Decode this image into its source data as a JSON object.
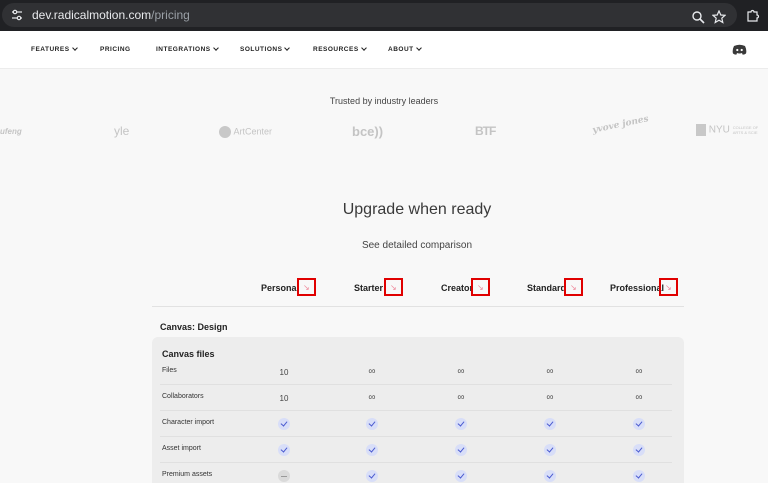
{
  "browser": {
    "url_host": "dev.radicalmotion.com",
    "url_path": "/pricing"
  },
  "nav": {
    "items": [
      {
        "label": "FEATURES",
        "dropdown": true
      },
      {
        "label": "PRICING",
        "dropdown": false
      },
      {
        "label": "INTEGRATIONS",
        "dropdown": true
      },
      {
        "label": "SOLUTIONS",
        "dropdown": true
      },
      {
        "label": "RESOURCES",
        "dropdown": true
      },
      {
        "label": "ABOUT",
        "dropdown": true
      }
    ]
  },
  "trusted": {
    "title": "Trusted by industry leaders",
    "logos": [
      "ufeng",
      "yle",
      "ArtCenter",
      "bce))",
      "BTF",
      "yvove jones",
      "NYU",
      "COLLEGE OF ARTS & SCIE"
    ]
  },
  "pricing": {
    "headline": "Upgrade when ready",
    "subheadline": "See detailed comparison",
    "plans": [
      "Personal",
      "Starter",
      "Creator",
      "Standard",
      "Professional"
    ],
    "section": "Canvas: Design",
    "group": "Canvas files",
    "rows": [
      {
        "label": "Files",
        "values": [
          "10",
          "∞",
          "∞",
          "∞",
          "∞"
        ]
      },
      {
        "label": "Collaborators",
        "values": [
          "10",
          "∞",
          "∞",
          "∞",
          "∞"
        ]
      },
      {
        "label": "Character import",
        "values": [
          "check",
          "check",
          "check",
          "check",
          "check"
        ]
      },
      {
        "label": "Asset import",
        "values": [
          "check",
          "check",
          "check",
          "check",
          "check"
        ]
      },
      {
        "label": "Premium assets",
        "values": [
          "dash",
          "check",
          "check",
          "check",
          "check"
        ]
      }
    ]
  },
  "colors": {
    "accent_check": "#4a5ad0",
    "highlight_box": "#e00000"
  }
}
